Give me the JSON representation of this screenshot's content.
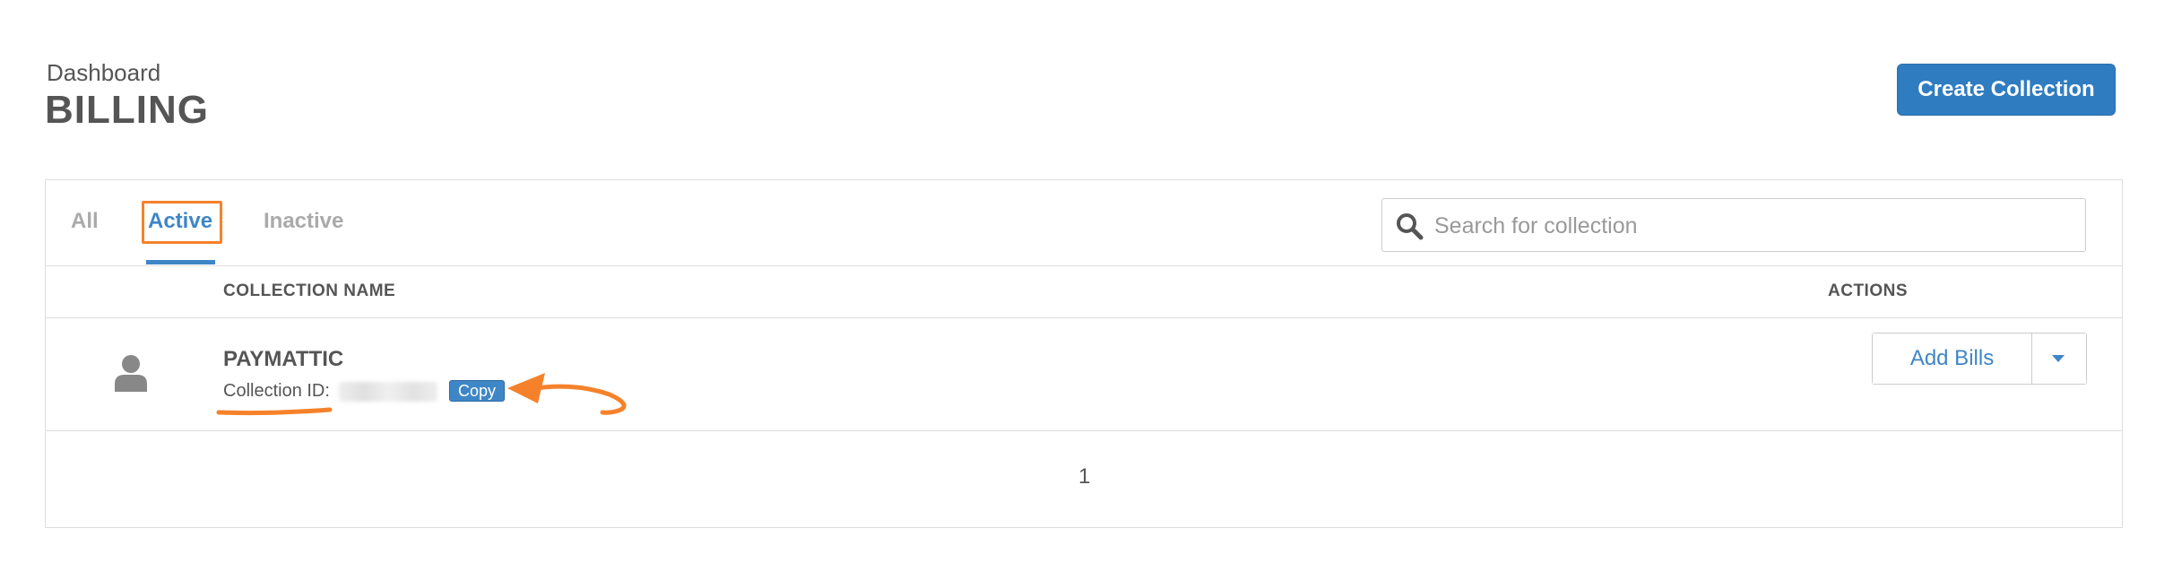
{
  "header": {
    "breadcrumb": "Dashboard",
    "title": "BILLING",
    "create_button_label": "Create Collection"
  },
  "tabs": [
    {
      "label": "All",
      "selected": false
    },
    {
      "label": "Active",
      "selected": true
    },
    {
      "label": "Inactive",
      "selected": false
    }
  ],
  "search": {
    "placeholder": "Search for collection",
    "value": "",
    "icon": "search-icon"
  },
  "table": {
    "columns": [
      "COLLECTION NAME",
      "ACTIONS"
    ],
    "rows": [
      {
        "avatar_icon": "user-icon",
        "name": "PAYMATTIC",
        "id_label": "Collection ID:",
        "id_value": "",
        "copy_label": "Copy",
        "action_label": "Add Bills",
        "action_menu_icon": "chevron-down-icon"
      }
    ]
  },
  "pagination": {
    "current_page": "1"
  },
  "colors": {
    "primary": "#2f7cc1",
    "link": "#3f86c7",
    "annotation": "#f5822a",
    "text": "#555555",
    "muted": "#aaaaaa"
  }
}
